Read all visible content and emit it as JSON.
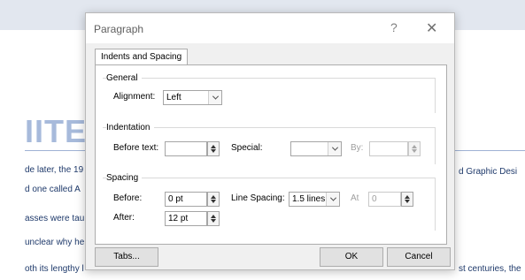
{
  "document": {
    "heading": "IITE",
    "lines": [
      "de later, the 19",
      "d one called A",
      "asses were tau",
      "unclear why he",
      "oth its lengthy l",
      "d Graphic Desi",
      "st centuries, the"
    ]
  },
  "dialog": {
    "title": "Paragraph",
    "help": "?",
    "close": "✕",
    "tab_label": "Indents and Spacing",
    "general": {
      "title": "General",
      "alignment_label": "Alignment:",
      "alignment_value": "Left"
    },
    "indentation": {
      "title": "Indentation",
      "before_text_label": "Before text:",
      "before_text_value": "",
      "special_label": "Special:",
      "special_value": "",
      "by_label": "By:",
      "by_value": ""
    },
    "spacing": {
      "title": "Spacing",
      "before_label": "Before:",
      "before_value": "0 pt",
      "after_label": "After:",
      "after_value": "12 pt",
      "line_spacing_label": "Line Spacing:",
      "line_spacing_value": "1.5 lines",
      "at_label": "At",
      "at_value": "0"
    },
    "buttons": {
      "tabs": "Tabs...",
      "ok": "OK",
      "cancel": "Cancel"
    }
  }
}
